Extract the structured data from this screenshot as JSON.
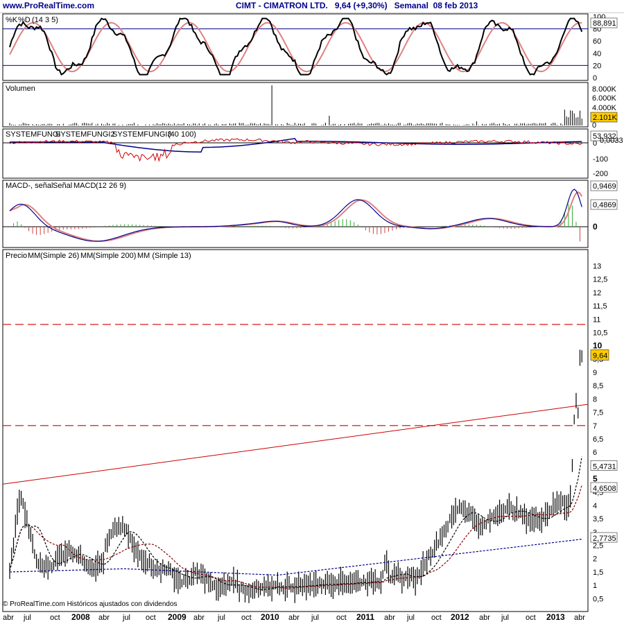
{
  "header": {
    "site": "www.ProRealTime.com",
    "title": "CIMT - CIMATRON LTD.   9,64 (+9,30%)   Semanal  08 feb 2013"
  },
  "footer": "© ProRealTime.com Históricos ajustados con dividendos",
  "colors": {
    "price_up": "#000000",
    "ma26": "#8b0000",
    "ma200": "#00008b",
    "ma13": "#000000",
    "trend": "#cc0000",
    "macd_pos": "#66cc66",
    "macd_neg": "#cc6666"
  },
  "x_axis": [
    "abr",
    "jul",
    "oct",
    "2008",
    "abr",
    "jul",
    "oct",
    "2009",
    "abr",
    "jul",
    "oct",
    "2010",
    "abr",
    "jul",
    "oct",
    "2011",
    "abr",
    "jul",
    "oct",
    "2012",
    "abr",
    "jul",
    "oct",
    "2013",
    "abr"
  ],
  "panels": {
    "stoch": {
      "legend_k": "%K",
      "legend_d": "%D",
      "legend_params": "(14 3 5)",
      "ticks": [
        "100",
        "80",
        "60",
        "40",
        "20",
        "0"
      ],
      "last": "88,891"
    },
    "volume": {
      "legend": "Volumen",
      "ticks": [
        "8.000K",
        "6.000K",
        "4.000K",
        "0"
      ],
      "last": "2.101K"
    },
    "fungi": {
      "legend1": "SYSTEMFUNGI",
      "legend2": "SYSTEMFUNGI2",
      "legend3": "SYSTEMFUNGI3",
      "params": "(40 100)",
      "ticks": [
        "0",
        "-100",
        "-200"
      ],
      "last1": "53,932",
      "last2": "0,0033"
    },
    "macd": {
      "legend1": "MACD-, señal",
      "legend2": "Señal",
      "legend3": "MACD",
      "params": "(12 26 9)",
      "ticks": [
        "0"
      ],
      "last1": "0,9469",
      "last2": "0,4869"
    },
    "price": {
      "legend0": "Precio",
      "legend1": "MM",
      "legend1b": "(Simple 26)",
      "legend2": "MM",
      "legend2b": "(Simple 200)",
      "legend3": "MM (Simple 13)",
      "ticks": [
        "13",
        "12,5",
        "12",
        "11,5",
        "11",
        "10,5",
        "10",
        "9,5",
        "9",
        "8,5",
        "8",
        "7,5",
        "7",
        "6,5",
        "6",
        "5,5",
        "5",
        "4,5",
        "4",
        "3,5",
        "3",
        "2,5",
        "2",
        "1,5",
        "1",
        "0,5"
      ],
      "last_price": "9,64",
      "last_ma13": "5,4731",
      "last_ma26": "4,6508",
      "last_ma200": "2,7735"
    }
  },
  "chart_data": {
    "type": "line",
    "title": "CIMT - CIMATRON LTD.   9,64 (+9,30%)   Semanal  08 feb 2013",
    "xlabel": "",
    "ylabel": "",
    "ylim": [
      0.3,
      13.3
    ],
    "categories": [
      "2007-04",
      "2007-07",
      "2007-10",
      "2008-01",
      "2008-04",
      "2008-07",
      "2008-10",
      "2009-01",
      "2009-04",
      "2009-07",
      "2009-10",
      "2010-01",
      "2010-04",
      "2010-07",
      "2010-10",
      "2011-01",
      "2011-04",
      "2011-07",
      "2011-10",
      "2012-01",
      "2012-04",
      "2012-07",
      "2012-10",
      "2013-01",
      "2013-02"
    ],
    "series": [
      {
        "name": "Precio",
        "values": [
          2.3,
          2.0,
          1.9,
          2.1,
          2.6,
          2.2,
          1.6,
          0.8,
          0.8,
          0.9,
          1.0,
          1.1,
          1.7,
          1.5,
          1.5,
          2.0,
          4.0,
          3.5,
          3.6,
          3.1,
          3.8,
          3.9,
          4.0,
          4.1,
          9.64
        ]
      },
      {
        "name": "MM (Simple 26)",
        "values": [
          2.2,
          2.4,
          2.1,
          2.0,
          2.2,
          2.4,
          2.1,
          1.6,
          1.0,
          0.9,
          0.9,
          1.0,
          1.1,
          1.3,
          1.5,
          1.6,
          2.6,
          3.4,
          3.5,
          3.4,
          3.5,
          3.7,
          3.8,
          4.0,
          4.6508
        ]
      },
      {
        "name": "MM (Simple 200)",
        "values": [
          1.5,
          1.6,
          1.6,
          1.7,
          1.7,
          1.7,
          1.6,
          1.3,
          1.2,
          1.1,
          1.1,
          1.1,
          1.2,
          1.3,
          1.35,
          1.45,
          1.7,
          1.85,
          2.0,
          2.1,
          2.2,
          2.3,
          2.4,
          2.55,
          2.7735
        ]
      },
      {
        "name": "MM (Simple 13)",
        "values": [
          2.3,
          2.3,
          2.0,
          2.0,
          2.4,
          2.3,
          1.9,
          1.2,
          0.8,
          0.9,
          0.9,
          1.0,
          1.5,
          1.5,
          1.5,
          1.8,
          3.6,
          3.5,
          3.5,
          3.3,
          3.7,
          3.8,
          3.9,
          4.1,
          5.4731
        ]
      }
    ],
    "trendline": [
      {
        "x": "2007-03",
        "y": 4.8
      },
      {
        "x": "2013-04",
        "y": 7.8
      }
    ],
    "horizontal_lines": [
      7.0,
      10.8
    ],
    "grid": false,
    "legend": "top-left"
  }
}
